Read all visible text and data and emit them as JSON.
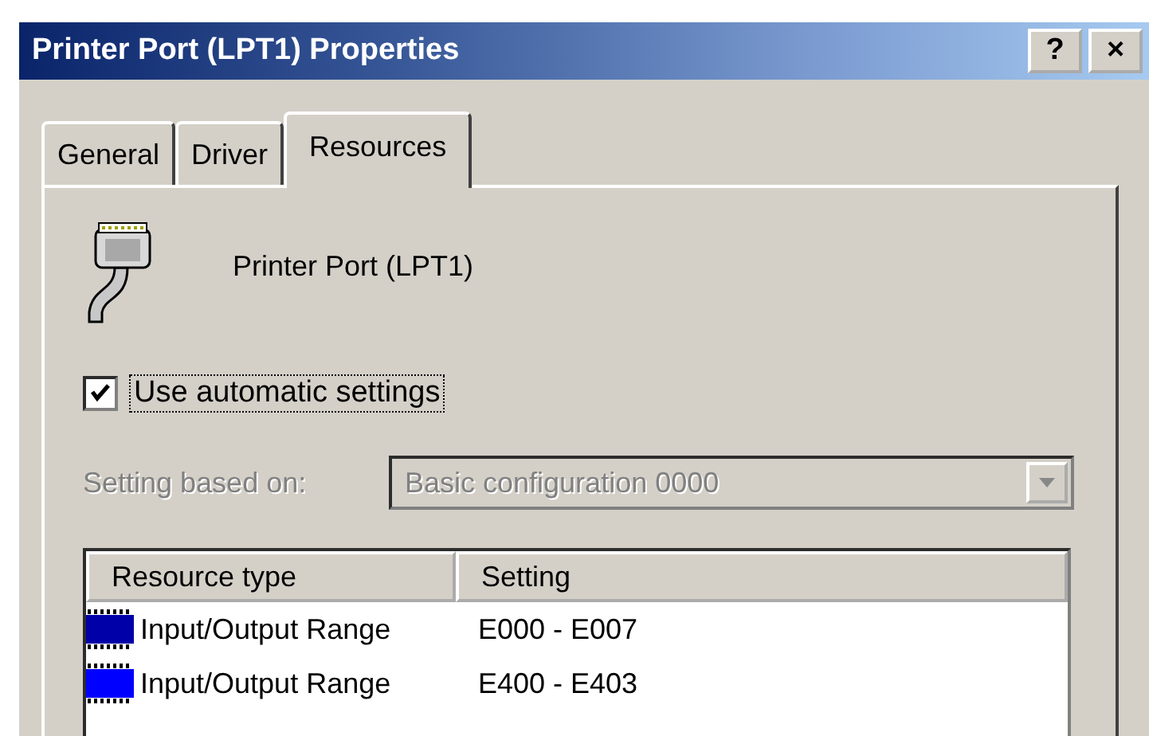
{
  "window": {
    "title": "Printer Port (LPT1) Properties",
    "buttons": [
      "?",
      "×"
    ]
  },
  "tabs": [
    {
      "label": "General",
      "selected": false
    },
    {
      "label": "Driver",
      "selected": false
    },
    {
      "label": "Resources",
      "selected": true
    }
  ],
  "device": {
    "name": "Printer Port (LPT1)"
  },
  "auto_settings": {
    "label": "Use automatic settings",
    "checked": true
  },
  "setting_based_on": {
    "label": "Setting based on:",
    "value": "Basic configuration 0000",
    "disabled": true
  },
  "resources": {
    "columns": [
      "Resource type",
      "Setting"
    ],
    "rows": [
      {
        "type": "Input/Output Range",
        "setting": "E000 - E007",
        "color": "#0000a8"
      },
      {
        "type": "Input/Output Range",
        "setting": "E400 - E403",
        "color": "#0000ff"
      }
    ]
  }
}
